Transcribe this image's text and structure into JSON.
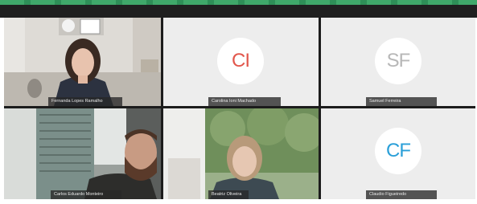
{
  "meeting": {
    "accent_color": "#3fa86a",
    "top_bar_color": "#1f1f1f"
  },
  "participants": [
    {
      "name": "Fernanda Lopes Ramalho",
      "initials": "",
      "kind": "video-camera-feed"
    },
    {
      "name": "Carolina Ioni Machado",
      "initials": "CI",
      "initials_color": "#e2574c",
      "kind": "avatar"
    },
    {
      "name": "Samuel Ferreira",
      "initials": "SF",
      "initials_color": "#b7b7b7",
      "kind": "avatar"
    },
    {
      "name": "Carlos Eduardo Monteiro",
      "initials": "",
      "kind": "video-camera-feed"
    },
    {
      "name": "Beatriz Oliveira",
      "initials": "",
      "kind": "video-camera-feed"
    },
    {
      "name": "Claudio Figueiredo",
      "initials": "CF",
      "initials_color": "#2a9fd8",
      "kind": "avatar"
    }
  ]
}
